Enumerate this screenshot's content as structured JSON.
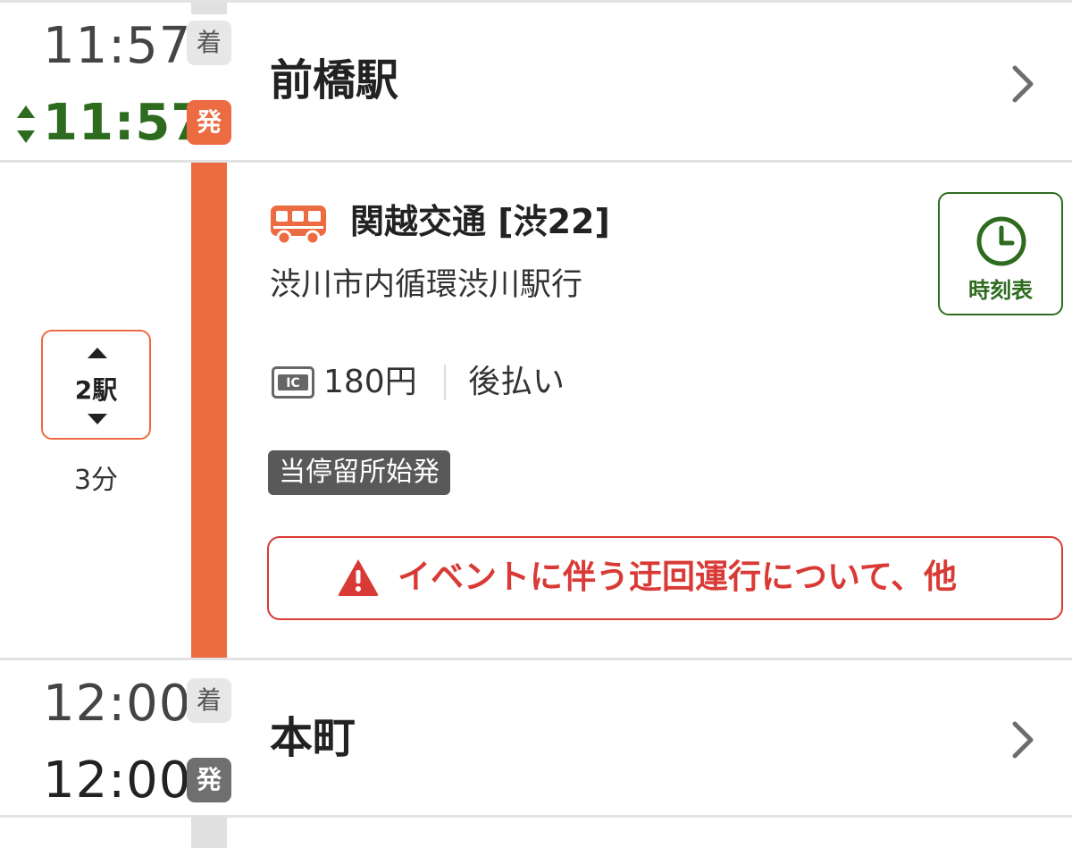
{
  "departure_stop": {
    "arrival_time": "11:57",
    "arrival_badge": "着",
    "departure_time": "11:57",
    "departure_badge": "発",
    "station_name": "前橋駅"
  },
  "ride": {
    "operator_line": "関越交通 [渋22]",
    "destination": "渋川市内循環渋川駅行",
    "timetable_label": "時刻表",
    "fare": "180円",
    "payment": "後払い",
    "origin_tag": "当停留所始発",
    "alert_text": "イベントに伴う迂回運行について、他",
    "stops_count": "2駅",
    "duration": "3分",
    "colors": {
      "line": "#ec6b40",
      "alert": "#d93a35",
      "timetable": "#2e6b1f"
    },
    "icons": [
      "bus-icon",
      "ic-card-icon",
      "warning-icon",
      "clock-icon",
      "updown-arrows-icon"
    ]
  },
  "arrival_stop": {
    "arrival_time": "12:00",
    "arrival_badge": "着",
    "departure_time": "12:00",
    "departure_badge": "発",
    "station_name": "本町"
  }
}
